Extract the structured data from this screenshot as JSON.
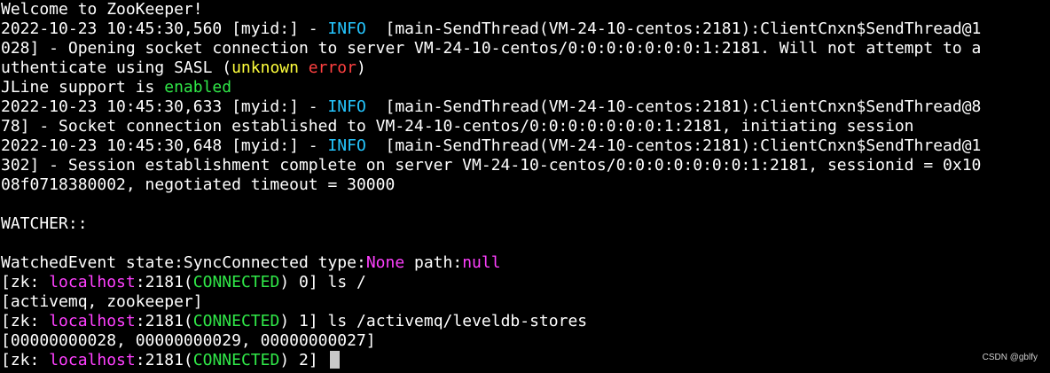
{
  "colors": {
    "background": "#000000",
    "text": "#ffffff",
    "info": "#25c6ff",
    "unknown": "#ffff3c",
    "error": "#ff4040",
    "connected": "#30e848",
    "magenta": "#ff40ff",
    "cursor": "#c8c8c8"
  },
  "terminal": {
    "welcome": "Welcome to ZooKeeper!",
    "log1": {
      "prefix": "2022-10-23 10:45:30,560 [myid:] - ",
      "level": "INFO",
      "rest": "  [main-SendThread(VM-24-10-centos:2181):ClientCnxn$SendThread@1",
      "cont1": "028] - Opening socket connection to server VM-24-10-centos/0:0:0:0:0:0:0:1:2181. Will not attempt to a",
      "cont2_a": "uthenticate using SASL (",
      "cont2_unknown": "unknown",
      "cont2_space": " ",
      "cont2_error": "error",
      "cont2_b": ")"
    },
    "jline": {
      "prefix": "JLine support is ",
      "status": "enabled"
    },
    "log2": {
      "prefix": "2022-10-23 10:45:30,633 [myid:] - ",
      "level": "INFO",
      "rest": "  [main-SendThread(VM-24-10-centos:2181):ClientCnxn$SendThread@8",
      "cont1": "78] - Socket connection established to VM-24-10-centos/0:0:0:0:0:0:0:1:2181, initiating session"
    },
    "log3": {
      "prefix": "2022-10-23 10:45:30,648 [myid:] - ",
      "level": "INFO",
      "rest": "  [main-SendThread(VM-24-10-centos:2181):ClientCnxn$SendThread@1",
      "cont1": "302] - Session establishment complete on server VM-24-10-centos/0:0:0:0:0:0:0:1:2181, sessionid = 0x10",
      "cont2": "08f0718380002, negotiated timeout = 30000"
    },
    "watcher": "WATCHER::",
    "event": {
      "a": "WatchedEvent state:SyncConnected type:",
      "type": "None",
      "b": " path:",
      "path": "null"
    },
    "prompt": {
      "open": "[zk: ",
      "host": "localhost",
      "port": ":2181(",
      "state": "CONNECTED",
      "close_paren": ") "
    },
    "cmd0": {
      "num": "0",
      "command": "] ls /"
    },
    "out0": "[activemq, zookeeper]",
    "cmd1": {
      "num": "1",
      "command": "] ls /activemq/leveldb-stores"
    },
    "out1": "[00000000028, 00000000029, 00000000027]",
    "cmd2": {
      "num": "2",
      "command": "] "
    }
  },
  "watermark": "CSDN @gblfy"
}
